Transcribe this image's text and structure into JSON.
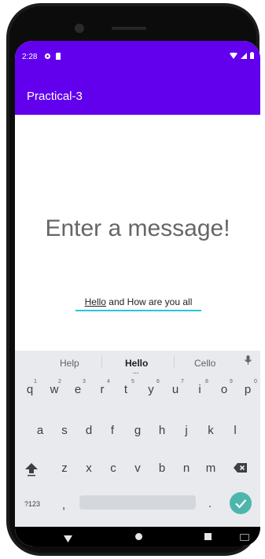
{
  "status_bar": {
    "time": "2:28",
    "left_icons": [
      "sync-icon",
      "sd-card-icon"
    ],
    "right_icons": [
      "wifi-icon",
      "signal-icon",
      "battery-icon"
    ]
  },
  "app_bar": {
    "title": "Practical-3",
    "color": "#6200ee"
  },
  "main": {
    "headline": "Enter a message!",
    "input_underlined_word": "Hello",
    "input_rest": " and How are you all",
    "accent": "#26c6da"
  },
  "keyboard": {
    "suggestions": [
      "Help",
      "Hello",
      "Cello"
    ],
    "suggestion_dots": "...",
    "row1": [
      "q",
      "w",
      "e",
      "r",
      "t",
      "y",
      "u",
      "i",
      "o",
      "p"
    ],
    "row1_hints": [
      "1",
      "2",
      "3",
      "4",
      "5",
      "6",
      "7",
      "8",
      "9",
      "0"
    ],
    "row2": [
      "a",
      "s",
      "d",
      "f",
      "g",
      "h",
      "j",
      "k",
      "l"
    ],
    "row3": [
      "z",
      "x",
      "c",
      "v",
      "b",
      "n",
      "m"
    ],
    "symbols_label": "?123",
    "comma": ",",
    "period": ".",
    "enter_color": "#4db6ac"
  },
  "nav_bar": {
    "icons": [
      "back-icon",
      "home-icon",
      "recents-icon",
      "keyboard-switch-icon"
    ]
  }
}
